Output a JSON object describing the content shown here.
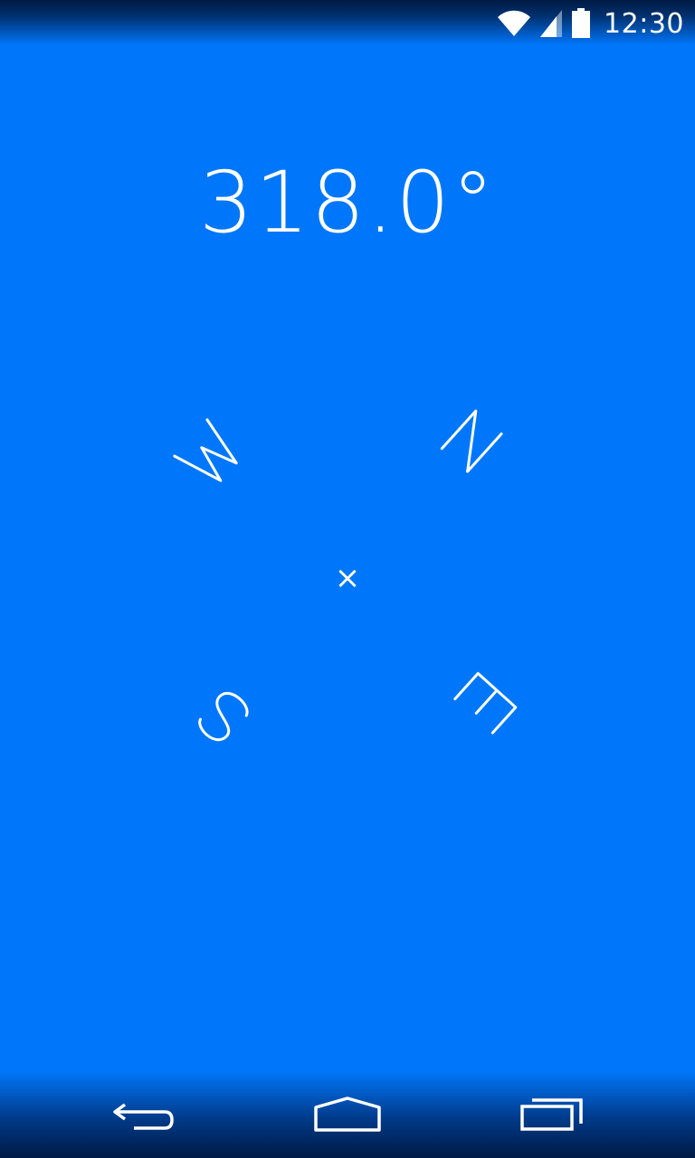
{
  "status_bar": {
    "time": "12:30",
    "icons": [
      "wifi-icon",
      "cell-signal-icon",
      "battery-icon"
    ]
  },
  "compass": {
    "heading_text": "318.0°",
    "heading_degrees": 318.0,
    "directions": [
      "N",
      "E",
      "S",
      "W"
    ],
    "center_marker": "×"
  },
  "nav_bar": {
    "buttons": [
      "back-icon",
      "home-icon",
      "recents-icon"
    ]
  },
  "colors": {
    "background": "#0077FA",
    "foreground": "#FFFFFF"
  }
}
